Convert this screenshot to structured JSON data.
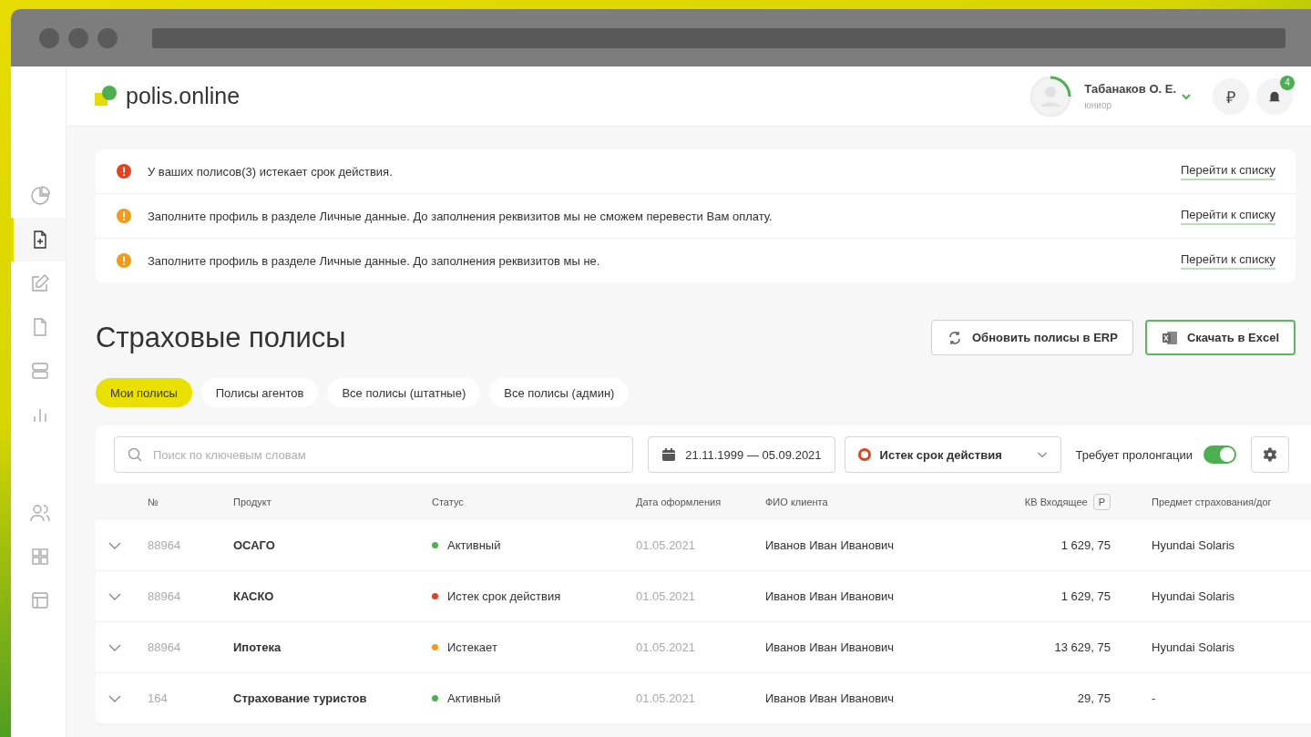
{
  "header": {
    "logo": "polis.online",
    "user": {
      "name": "Табанаков О. Е.",
      "role": "юниор"
    },
    "currency": "₽",
    "notifications": "4"
  },
  "sidebar": {
    "groups": [
      [
        {
          "selected": false
        },
        {
          "selected": true
        },
        {
          "selected": false
        },
        {
          "selected": false
        },
        {
          "selected": false
        },
        {
          "selected": false
        }
      ],
      [
        {
          "selected": false
        },
        {
          "selected": false
        },
        {
          "selected": false
        }
      ]
    ]
  },
  "alerts": [
    {
      "color": "#e2431e",
      "text": "У ваших полисов(3) истекает срок действия.",
      "link": "Перейти к списку"
    },
    {
      "color": "#f39a17",
      "text": "Заполните профиль в разделе Личные данные. До заполнения реквизитов мы не сможем перевести Вам оплату.",
      "link": "Перейти к списку"
    },
    {
      "color": "#f39a17",
      "text": "Заполните профиль в разделе Личные данные. До заполнения реквизитов мы не.",
      "link": "Перейти к списку"
    }
  ],
  "page_title": "Страховые полисы",
  "actions": [
    {
      "kind": "refresh",
      "label": "Обновить полисы в ERP"
    },
    {
      "kind": "excel",
      "label": "Скачать в Excel"
    }
  ],
  "tabs": [
    {
      "label": "Мои полисы",
      "selected": true
    },
    {
      "label": "Полисы агентов",
      "selected": false
    },
    {
      "label": "Все полисы (штатные)",
      "selected": false
    },
    {
      "label": "Все полисы (админ)",
      "selected": false
    }
  ],
  "filters": {
    "search": {
      "placeholder": "Поиск по ключевым словам"
    },
    "date_range": "21.11.1999 — 05.09.2021",
    "status": {
      "value": "Истек срок действия",
      "color": "#e2431e"
    },
    "toggle": {
      "label": "Требует пролонгации",
      "on": true
    }
  },
  "table": {
    "columns": [
      {
        "label": "№"
      },
      {
        "label": "Продукт"
      },
      {
        "label": "Статус"
      },
      {
        "label": "Дата оформления"
      },
      {
        "label": "ФИО клиента"
      },
      {
        "label": "КВ Входящее",
        "badge": "Р"
      },
      {
        "label": "Предмет страхования/дог"
      }
    ],
    "rows": [
      {
        "number": "88964",
        "product": "ОСАГО",
        "status": {
          "text": "Активный",
          "color": "#4caf50"
        },
        "date": "01.05.2021",
        "client": "Иванов Иван Иванович",
        "commission": "1 629, 75",
        "subject": "Hyundai Solaris"
      },
      {
        "number": "88964",
        "product": "КАСКО",
        "status": {
          "text": "Истек срок действия",
          "color": "#e2431e"
        },
        "date": "01.05.2021",
        "client": "Иванов Иван Иванович",
        "commission": "1 629, 75",
        "subject": "Hyundai Solaris"
      },
      {
        "number": "88964",
        "product": "Ипотека",
        "status": {
          "text": "Истекает",
          "color": "#f39a17"
        },
        "date": "01.05.2021",
        "client": "Иванов Иван Иванович",
        "commission": "13 629, 75",
        "subject": "Hyundai Solaris"
      },
      {
        "number": "164",
        "product": "Страхование туристов",
        "status": {
          "text": "Активный",
          "color": "#4caf50"
        },
        "date": "01.05.2021",
        "client": "Иванов Иван Иванович",
        "commission": "29, 75",
        "subject": "-"
      }
    ]
  }
}
